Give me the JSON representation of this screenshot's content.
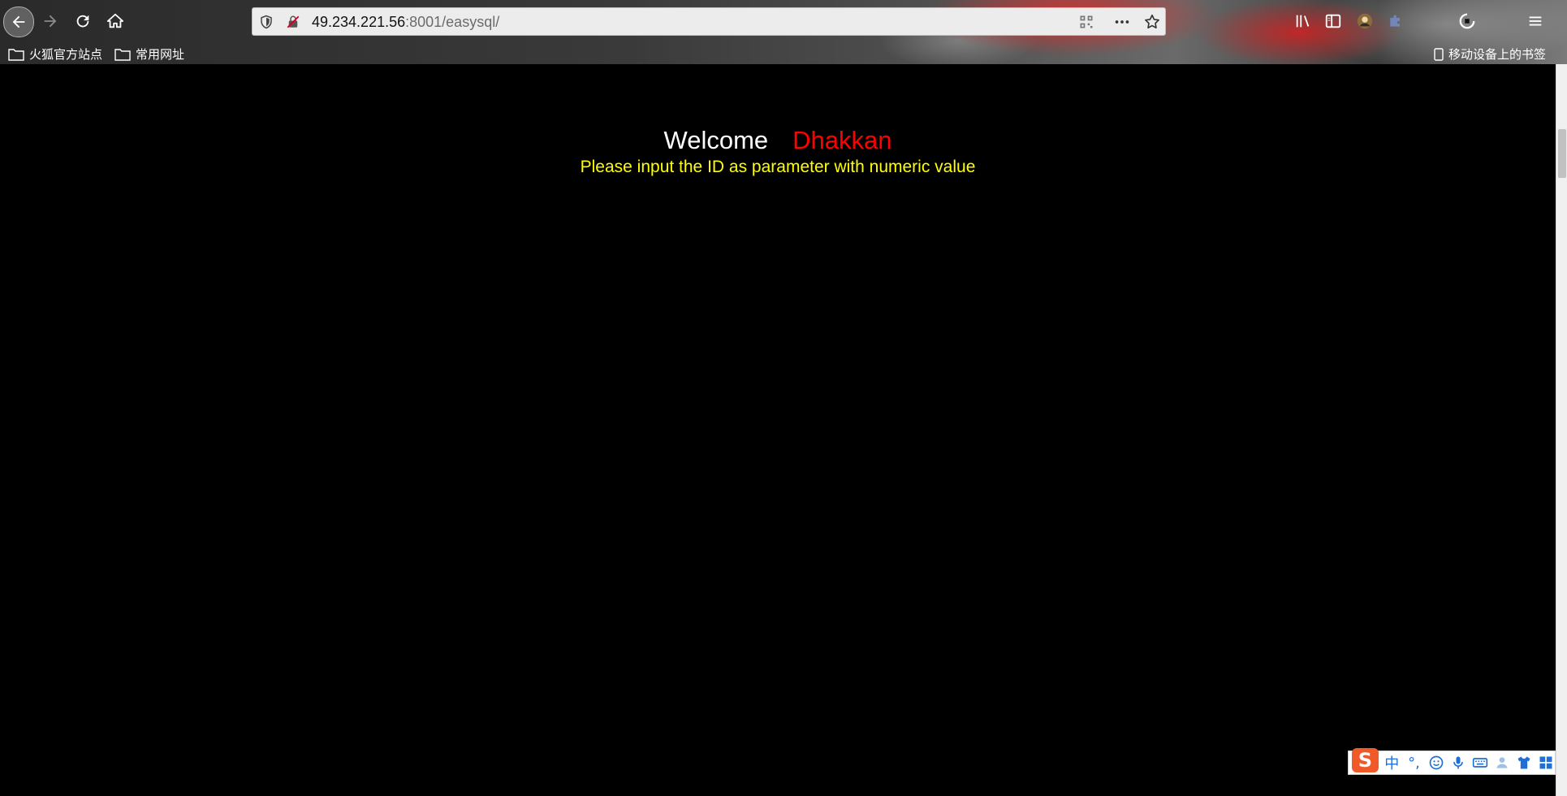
{
  "browser": {
    "url_host": "49.234.221.56",
    "url_rest": ":8001/easysql/",
    "bookmarks": [
      {
        "label": "火狐官方站点"
      },
      {
        "label": "常用网址"
      }
    ],
    "mobile_bookmarks": "移动设备上的书签"
  },
  "page": {
    "welcome_label": "Welcome",
    "welcome_name": "Dhakkan",
    "prompt": "Please input the ID as parameter with numeric value"
  },
  "ime": {
    "mode": "中",
    "punct": "°,"
  },
  "colors": {
    "background": "#000000",
    "welcome": "#ffffff",
    "name": "#ff0000",
    "prompt": "#ffff00"
  }
}
